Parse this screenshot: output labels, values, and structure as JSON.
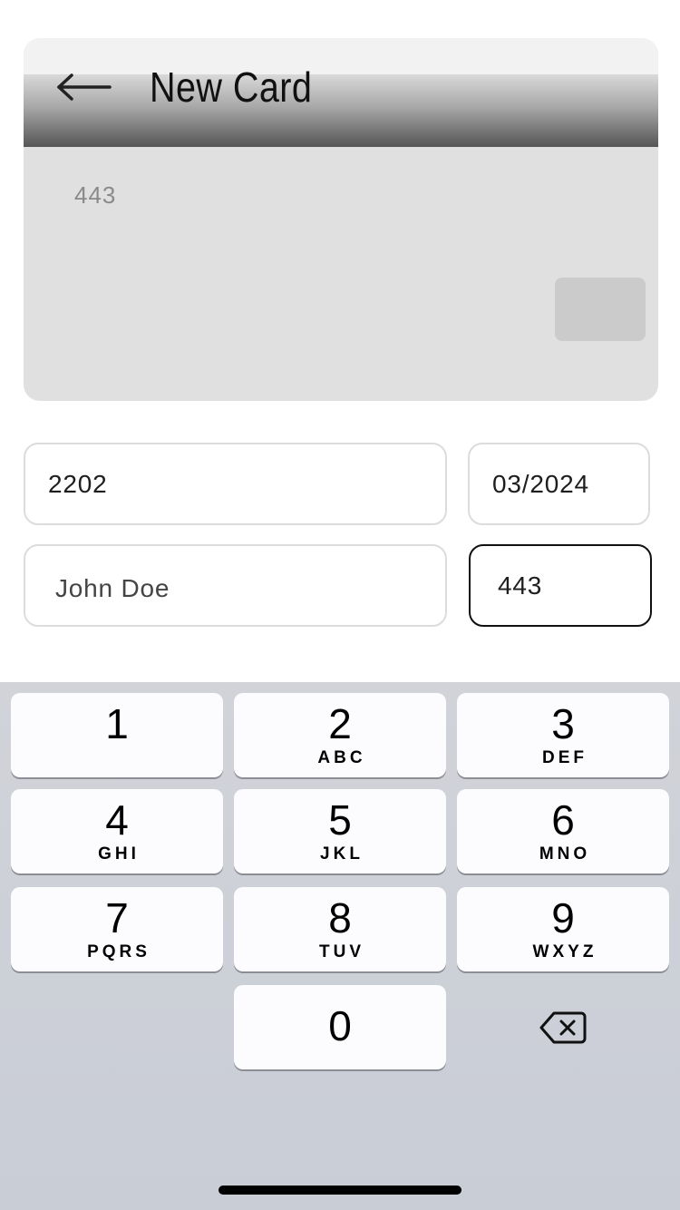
{
  "header": {
    "title": "New Card",
    "back_icon": "arrow-left-icon"
  },
  "card_preview": {
    "cvv": "443",
    "chip_color": "#cbcbcb"
  },
  "form": {
    "card_number": "2202",
    "expiry": "03/2024",
    "holder_name": "John Doe",
    "cvv": "443"
  },
  "keyboard": {
    "keys": [
      {
        "digit": "1",
        "letters": ""
      },
      {
        "digit": "2",
        "letters": "ABC"
      },
      {
        "digit": "3",
        "letters": "DEF"
      },
      {
        "digit": "4",
        "letters": "GHI"
      },
      {
        "digit": "5",
        "letters": "JKL"
      },
      {
        "digit": "6",
        "letters": "MNO"
      },
      {
        "digit": "7",
        "letters": "PQRS"
      },
      {
        "digit": "8",
        "letters": "TUV"
      },
      {
        "digit": "9",
        "letters": "WXYZ"
      },
      {
        "digit": "0",
        "letters": ""
      }
    ],
    "backspace_icon": "backspace-icon"
  },
  "colors": {
    "active_border": "#111111",
    "field_border": "#dcdcdc",
    "keyboard_bg": "#d1d3d9"
  }
}
